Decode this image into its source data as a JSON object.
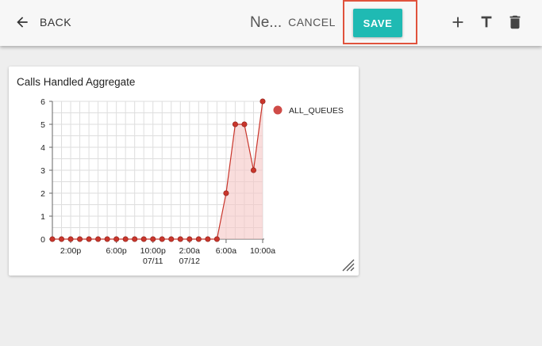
{
  "toolbar": {
    "back_label": "BACK",
    "dashboard_name": "Ne...",
    "cancel_label": "CANCEL",
    "save_label": "SAVE",
    "icons": [
      "arrow-back-icon",
      "add-icon",
      "text-icon",
      "delete-icon"
    ],
    "save_color": "#1fbab3",
    "highlight_color": "#e0533d"
  },
  "widget": {
    "title": "Calls Handled Aggregate"
  },
  "chart_data": {
    "type": "area",
    "title": "Calls Handled Aggregate",
    "xlabel": "",
    "ylabel": "",
    "ylim": [
      0,
      6
    ],
    "yticks": [
      "0",
      "1",
      "2",
      "3",
      "4",
      "5",
      "6"
    ],
    "xticks": [
      {
        "index": 2,
        "label": "2:00p",
        "sub": ""
      },
      {
        "index": 7,
        "label": "6:00p",
        "sub": ""
      },
      {
        "index": 11,
        "label": "10:00p",
        "sub": "07/11"
      },
      {
        "index": 15,
        "label": "2:00a",
        "sub": "07/12"
      },
      {
        "index": 19,
        "label": "6:00a",
        "sub": ""
      },
      {
        "index": 23,
        "label": "10:00a",
        "sub": ""
      }
    ],
    "series": [
      {
        "name": "ALL_QUEUES",
        "color": "#c9362c",
        "values": [
          0,
          0,
          0,
          0,
          0,
          0,
          0,
          0,
          0,
          0,
          0,
          0,
          0,
          0,
          0,
          0,
          0,
          0,
          0,
          2,
          5,
          5,
          3,
          6
        ]
      }
    ],
    "grid": true,
    "legend": "right"
  }
}
